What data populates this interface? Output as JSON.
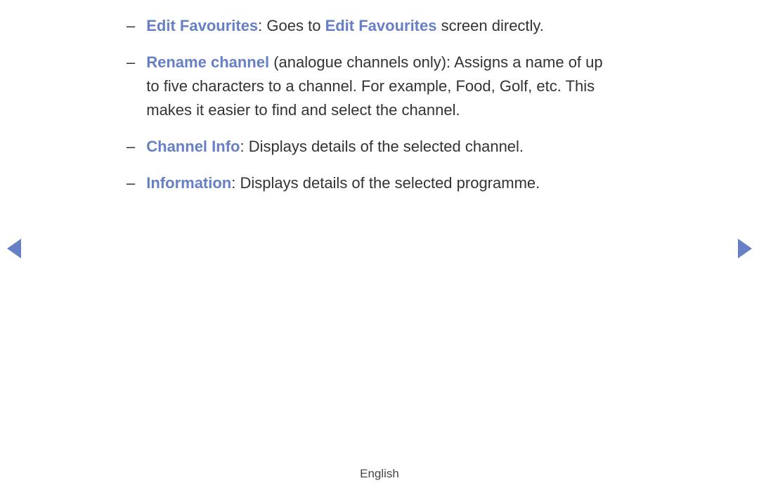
{
  "items": [
    {
      "dash": "–",
      "term": "Edit Favourites",
      "sep": ": ",
      "pre_inline": "Goes to ",
      "inline_term": "Edit Favourites",
      "post_inline": " screen directly."
    },
    {
      "dash": "–",
      "term": "Rename channel",
      "sep": " ",
      "desc": "(analogue channels only): Assigns a name of up to five characters to a channel. For example, Food, Golf, etc. This makes it easier to find and select the channel."
    },
    {
      "dash": "–",
      "term": "Channel Info",
      "sep": ": ",
      "desc": "Displays details of the selected channel."
    },
    {
      "dash": "–",
      "term": "Information",
      "sep": ": ",
      "desc": "Displays details of the selected programme."
    }
  ],
  "footer": {
    "language": "English"
  }
}
